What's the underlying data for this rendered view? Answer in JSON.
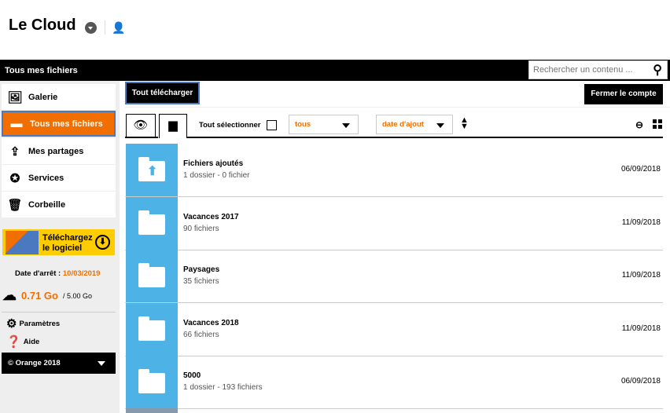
{
  "header": {
    "title": "Le Cloud",
    "dropdown_icon": "caret-circle-icon",
    "user_icon": "user-mail-icon"
  },
  "topbar": {
    "title": "Tous mes fichiers",
    "search_placeholder": "Rechercher un contenu ..."
  },
  "sidebar": {
    "items": [
      {
        "label": "Galerie",
        "icon": "image-icon"
      },
      {
        "label": "Tous mes fichiers",
        "icon": "folder-icon",
        "active": true
      },
      {
        "label": "Mes partages",
        "icon": "share-icon"
      },
      {
        "label": "Services",
        "icon": "award-icon"
      },
      {
        "label": "Corbeille",
        "icon": "trash-icon"
      }
    ],
    "promo": {
      "line1": "Téléchargez",
      "line2": "le logiciel"
    },
    "date_label": "Date d'arrêt :",
    "date_value": "10/03/2019",
    "used": "0.71 Go",
    "total": "/ 5.00 Go",
    "settings": "Paramètres",
    "help": "Aide",
    "footer": "© Orange 2018"
  },
  "toolbar": {
    "download_all": "Tout télécharger",
    "close_account": "Fermer le compte",
    "select_all": "Tout sélectionner",
    "filter": "tous",
    "sort": "date d'ajout"
  },
  "files": [
    {
      "name": "Fichiers ajoutés",
      "info": "1 dossier - 0 fichier",
      "date": "06/09/2018",
      "upload": true
    },
    {
      "name": "Vacances 2017",
      "info": "90 fichiers",
      "date": "11/09/2018"
    },
    {
      "name": "Paysages",
      "info": "35 fichiers",
      "date": "11/09/2018"
    },
    {
      "name": "Vacances 2018",
      "info": "66 fichiers",
      "date": "11/09/2018"
    },
    {
      "name": "5000",
      "info": "1 dossier - 193 fichiers",
      "date": "06/09/2018"
    }
  ],
  "colors": {
    "accent": "#f16e00",
    "folder": "#4db3e6",
    "promo": "#ffcc00"
  }
}
